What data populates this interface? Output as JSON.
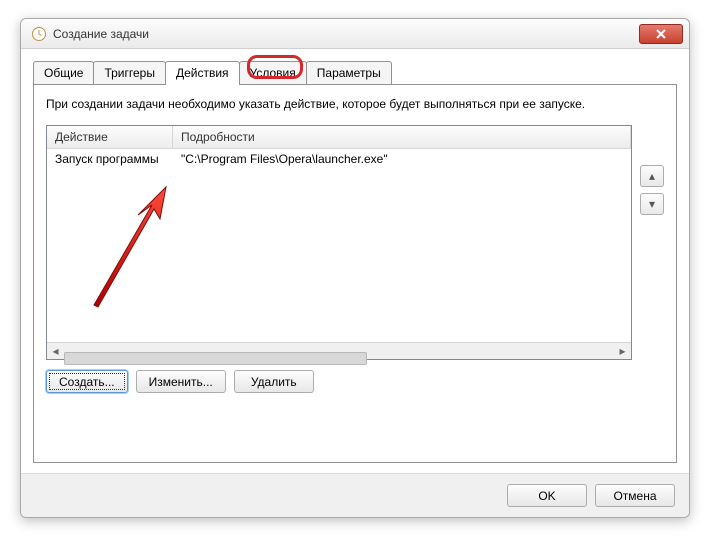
{
  "window": {
    "title": "Создание задачи"
  },
  "tabs": {
    "general": "Общие",
    "triggers": "Триггеры",
    "actions": "Действия",
    "conditions": "Условия",
    "settings": "Параметры"
  },
  "panel": {
    "hint": "При создании задачи необходимо указать действие, которое будет выполняться при ее запуске.",
    "columns": {
      "action": "Действие",
      "details": "Подробности"
    },
    "rows": [
      {
        "action": "Запуск программы",
        "details": "\"C:\\Program Files\\Opera\\launcher.exe\""
      }
    ],
    "buttons": {
      "create": "Создать...",
      "edit": "Изменить...",
      "delete": "Удалить"
    }
  },
  "footer": {
    "ok": "OK",
    "cancel": "Отмена"
  }
}
